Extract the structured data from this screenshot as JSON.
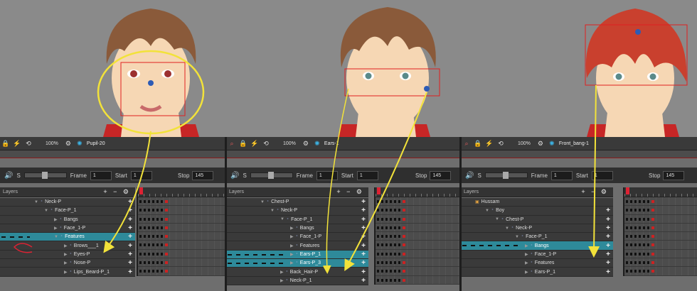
{
  "panels": [
    {
      "drawing_name": "Pupil-20",
      "zoom": "100%",
      "frame_label": "Frame",
      "frame": "1",
      "start_label": "Start",
      "start": "1",
      "stop_label": "Stop",
      "stop": "145",
      "layers_header": "Layers",
      "layers": [
        "Neck-P",
        "Face-P_1",
        "Bangs",
        "Face_1-P",
        "Features",
        "Brows___1",
        "Eyes-P",
        "Nose-P",
        "Lips_Beard-P_1"
      ],
      "selected_layer": "Features"
    },
    {
      "drawing_name": "Ears-1",
      "zoom": "100%",
      "frame_label": "Frame",
      "frame": "1",
      "start_label": "Start",
      "start": "1",
      "stop_label": "Stop",
      "stop": "145",
      "layers_header": "Layers",
      "layers": [
        "Chest-P",
        "Neck-P",
        "Face-P_1",
        "Bangs",
        "Face_1-P",
        "Features",
        "Ears-P_1",
        "Ears-P_3",
        "Back_Hair-P",
        "Neck-P_1"
      ],
      "selected_layers": [
        "Ears-P_1",
        "Ears-P_3"
      ]
    },
    {
      "drawing_name": "Front_bang-1",
      "zoom": "100%",
      "frame_label": "Frame",
      "frame": "1",
      "start_label": "Start",
      "start": "1",
      "stop_label": "Stop",
      "stop": "145",
      "layers_header": "Layers",
      "layers": [
        "Hussam",
        "Boy",
        "Chest-P",
        "Neck-P",
        "Face-P_1",
        "Bangs",
        "Face_1-P",
        "Features",
        "Ears-P_1"
      ],
      "selected_layer": "Bangs"
    }
  ],
  "colors": {
    "selection": "#2e8a9a",
    "annotation": "#f2e23a",
    "transform_box": "#e02020",
    "pivot": "#2d5bb5",
    "hair_brown": "#8a5a3a",
    "hair_red": "#c9402e",
    "skin": "#f6d7b4"
  }
}
